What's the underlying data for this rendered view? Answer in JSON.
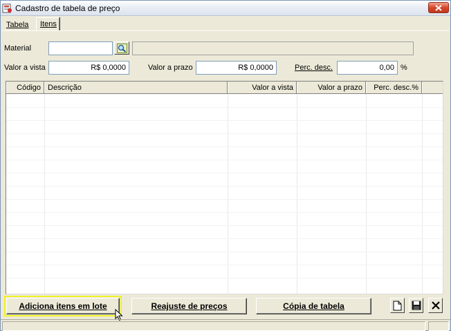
{
  "window": {
    "title": "Cadastro de tabela de preço"
  },
  "tabs": [
    {
      "label": "Tabela"
    },
    {
      "label": "Itens"
    }
  ],
  "form": {
    "material_label": "Material",
    "material_value": "",
    "material_description": "",
    "valor_vista_label": "Valor a vista",
    "valor_vista_value": "R$ 0,0000",
    "valor_prazo_label": "Valor a prazo",
    "valor_prazo_value": "R$ 0,0000",
    "perc_desc_label": "Perc. desc.",
    "perc_desc_value": "0,00",
    "perc_unit": "%"
  },
  "grid": {
    "columns": [
      "Código",
      "Descrição",
      "Valor a vista",
      "Valor a prazo",
      "Perc. desc.%"
    ],
    "rows": []
  },
  "buttons": {
    "adiciona": "Adiciona itens em lote",
    "reajuste": "Reajuste de preços",
    "copia": "Cópia de tabela"
  },
  "icons": {
    "app": "app-icon",
    "lookup": "search-icon",
    "new": "new-document-icon",
    "save": "save-icon",
    "delete": "close-icon"
  },
  "colors": {
    "highlight": "#f1f128",
    "close_button": "#d6472b"
  }
}
